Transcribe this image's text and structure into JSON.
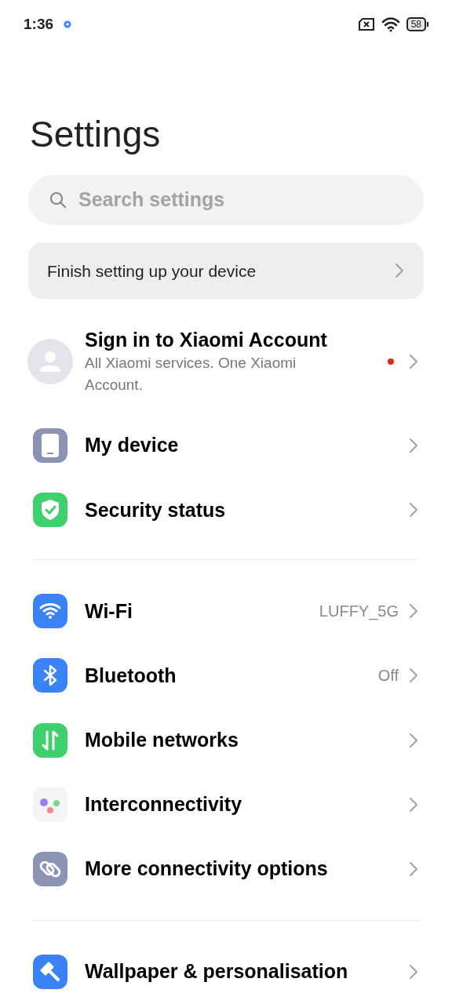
{
  "status_bar": {
    "time": "1:36",
    "battery": "58"
  },
  "title": "Settings",
  "search": {
    "placeholder": "Search settings"
  },
  "setup_banner": {
    "label": "Finish setting up your device"
  },
  "account": {
    "title": "Sign in to Xiaomi Account",
    "subtitle": "All Xiaomi services. One Xiaomi Account.",
    "unread": true
  },
  "groups": [
    {
      "items": [
        {
          "label": "My device"
        },
        {
          "label": "Security status"
        }
      ]
    },
    {
      "items": [
        {
          "label": "Wi-Fi",
          "value": "LUFFY_5G"
        },
        {
          "label": "Bluetooth",
          "value": "Off"
        },
        {
          "label": "Mobile networks"
        },
        {
          "label": "Interconnectivity"
        },
        {
          "label": "More connectivity options"
        }
      ]
    },
    {
      "items": [
        {
          "label": "Wallpaper & personalisation"
        }
      ]
    }
  ]
}
